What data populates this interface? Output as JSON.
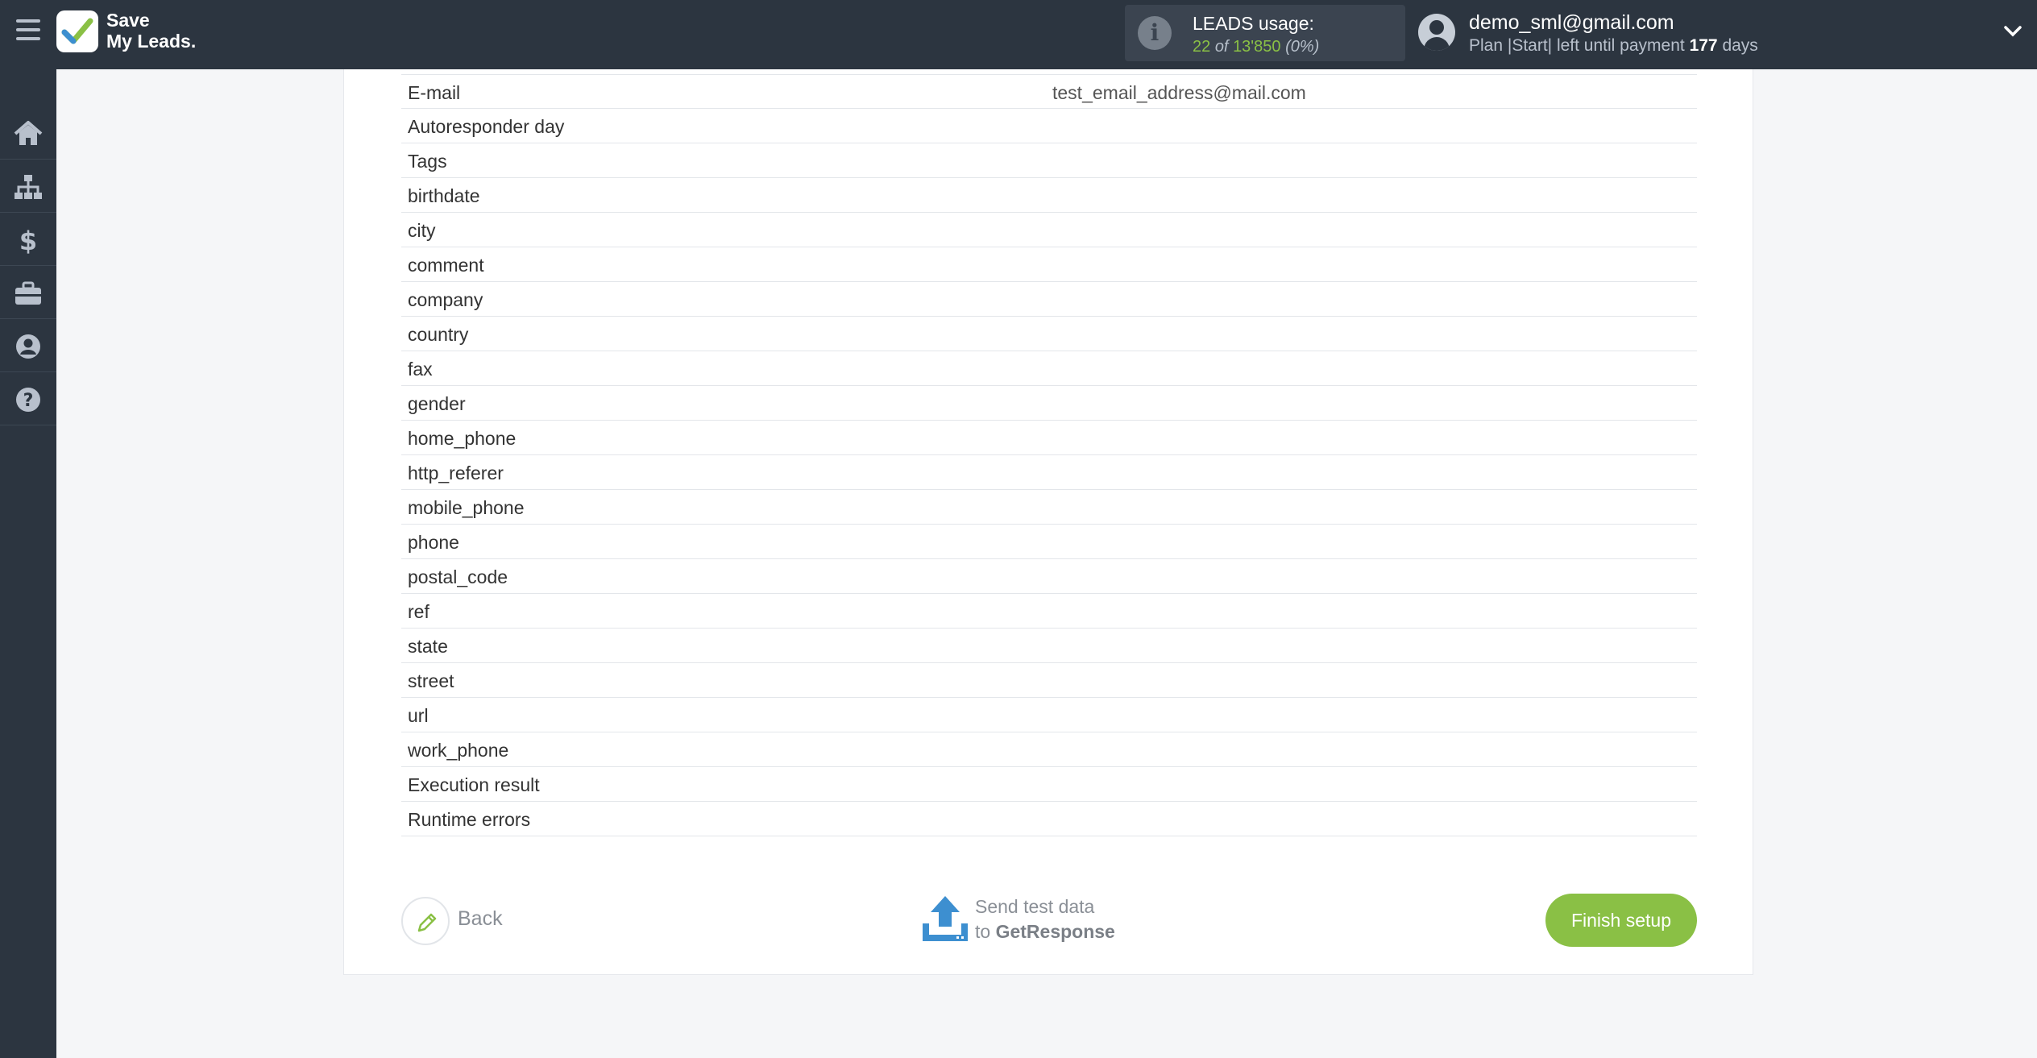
{
  "brand": {
    "name_line1": "Save",
    "name_line2": "My Leads."
  },
  "usage": {
    "label": "LEADS usage:",
    "used": "22",
    "of": "of",
    "total": "13'850",
    "percent": "(0%)"
  },
  "user": {
    "email": "demo_sml@gmail.com",
    "plan_prefix": "Plan |Start| left until payment",
    "days_count": "177",
    "days_label": "days"
  },
  "sidebar": {
    "items": [
      "home-icon",
      "sitemap-icon",
      "dollar-icon",
      "briefcase-icon",
      "user-circle-icon",
      "help-icon"
    ]
  },
  "fields": [
    {
      "name": "E-mail",
      "value": "test_email_address@mail.com"
    },
    {
      "name": "Autoresponder day",
      "value": ""
    },
    {
      "name": "Tags",
      "value": ""
    },
    {
      "name": "birthdate",
      "value": ""
    },
    {
      "name": "city",
      "value": ""
    },
    {
      "name": "comment",
      "value": ""
    },
    {
      "name": "company",
      "value": ""
    },
    {
      "name": "country",
      "value": ""
    },
    {
      "name": "fax",
      "value": ""
    },
    {
      "name": "gender",
      "value": ""
    },
    {
      "name": "home_phone",
      "value": ""
    },
    {
      "name": "http_referer",
      "value": ""
    },
    {
      "name": "mobile_phone",
      "value": ""
    },
    {
      "name": "phone",
      "value": ""
    },
    {
      "name": "postal_code",
      "value": ""
    },
    {
      "name": "ref",
      "value": ""
    },
    {
      "name": "state",
      "value": ""
    },
    {
      "name": "street",
      "value": ""
    },
    {
      "name": "url",
      "value": ""
    },
    {
      "name": "work_phone",
      "value": ""
    },
    {
      "name": "Execution result",
      "value": ""
    },
    {
      "name": "Runtime errors",
      "value": ""
    }
  ],
  "actions": {
    "back_label": "Back",
    "send_line1": "Send test data",
    "send_to": "to",
    "send_target": "GetResponse",
    "finish_label": "Finish setup"
  },
  "colors": {
    "accent": "#8ac045",
    "topbar": "#2c3540",
    "send_icon": "#3d8fd0"
  }
}
